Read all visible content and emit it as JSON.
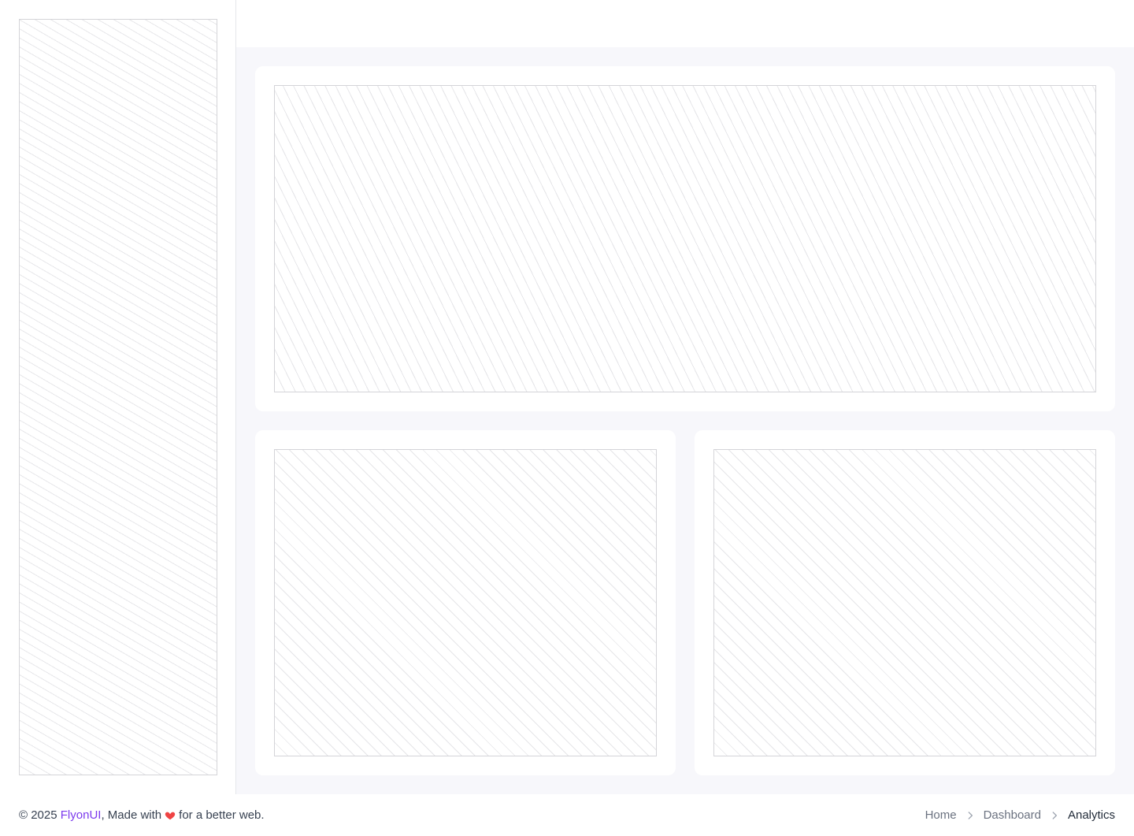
{
  "footer": {
    "copyright_prefix": "© 2025 ",
    "brand": "FlyonUI",
    "made_with": ", Made with",
    "tagline_suffix": "for a better web.",
    "heart_icon": "heart-icon",
    "heart_color": "#ef4444",
    "brand_color": "#7c3aed"
  },
  "breadcrumb": {
    "items": [
      "Home",
      "Dashboard",
      "Analytics"
    ],
    "separator_icon": "chevron-right-icon"
  }
}
